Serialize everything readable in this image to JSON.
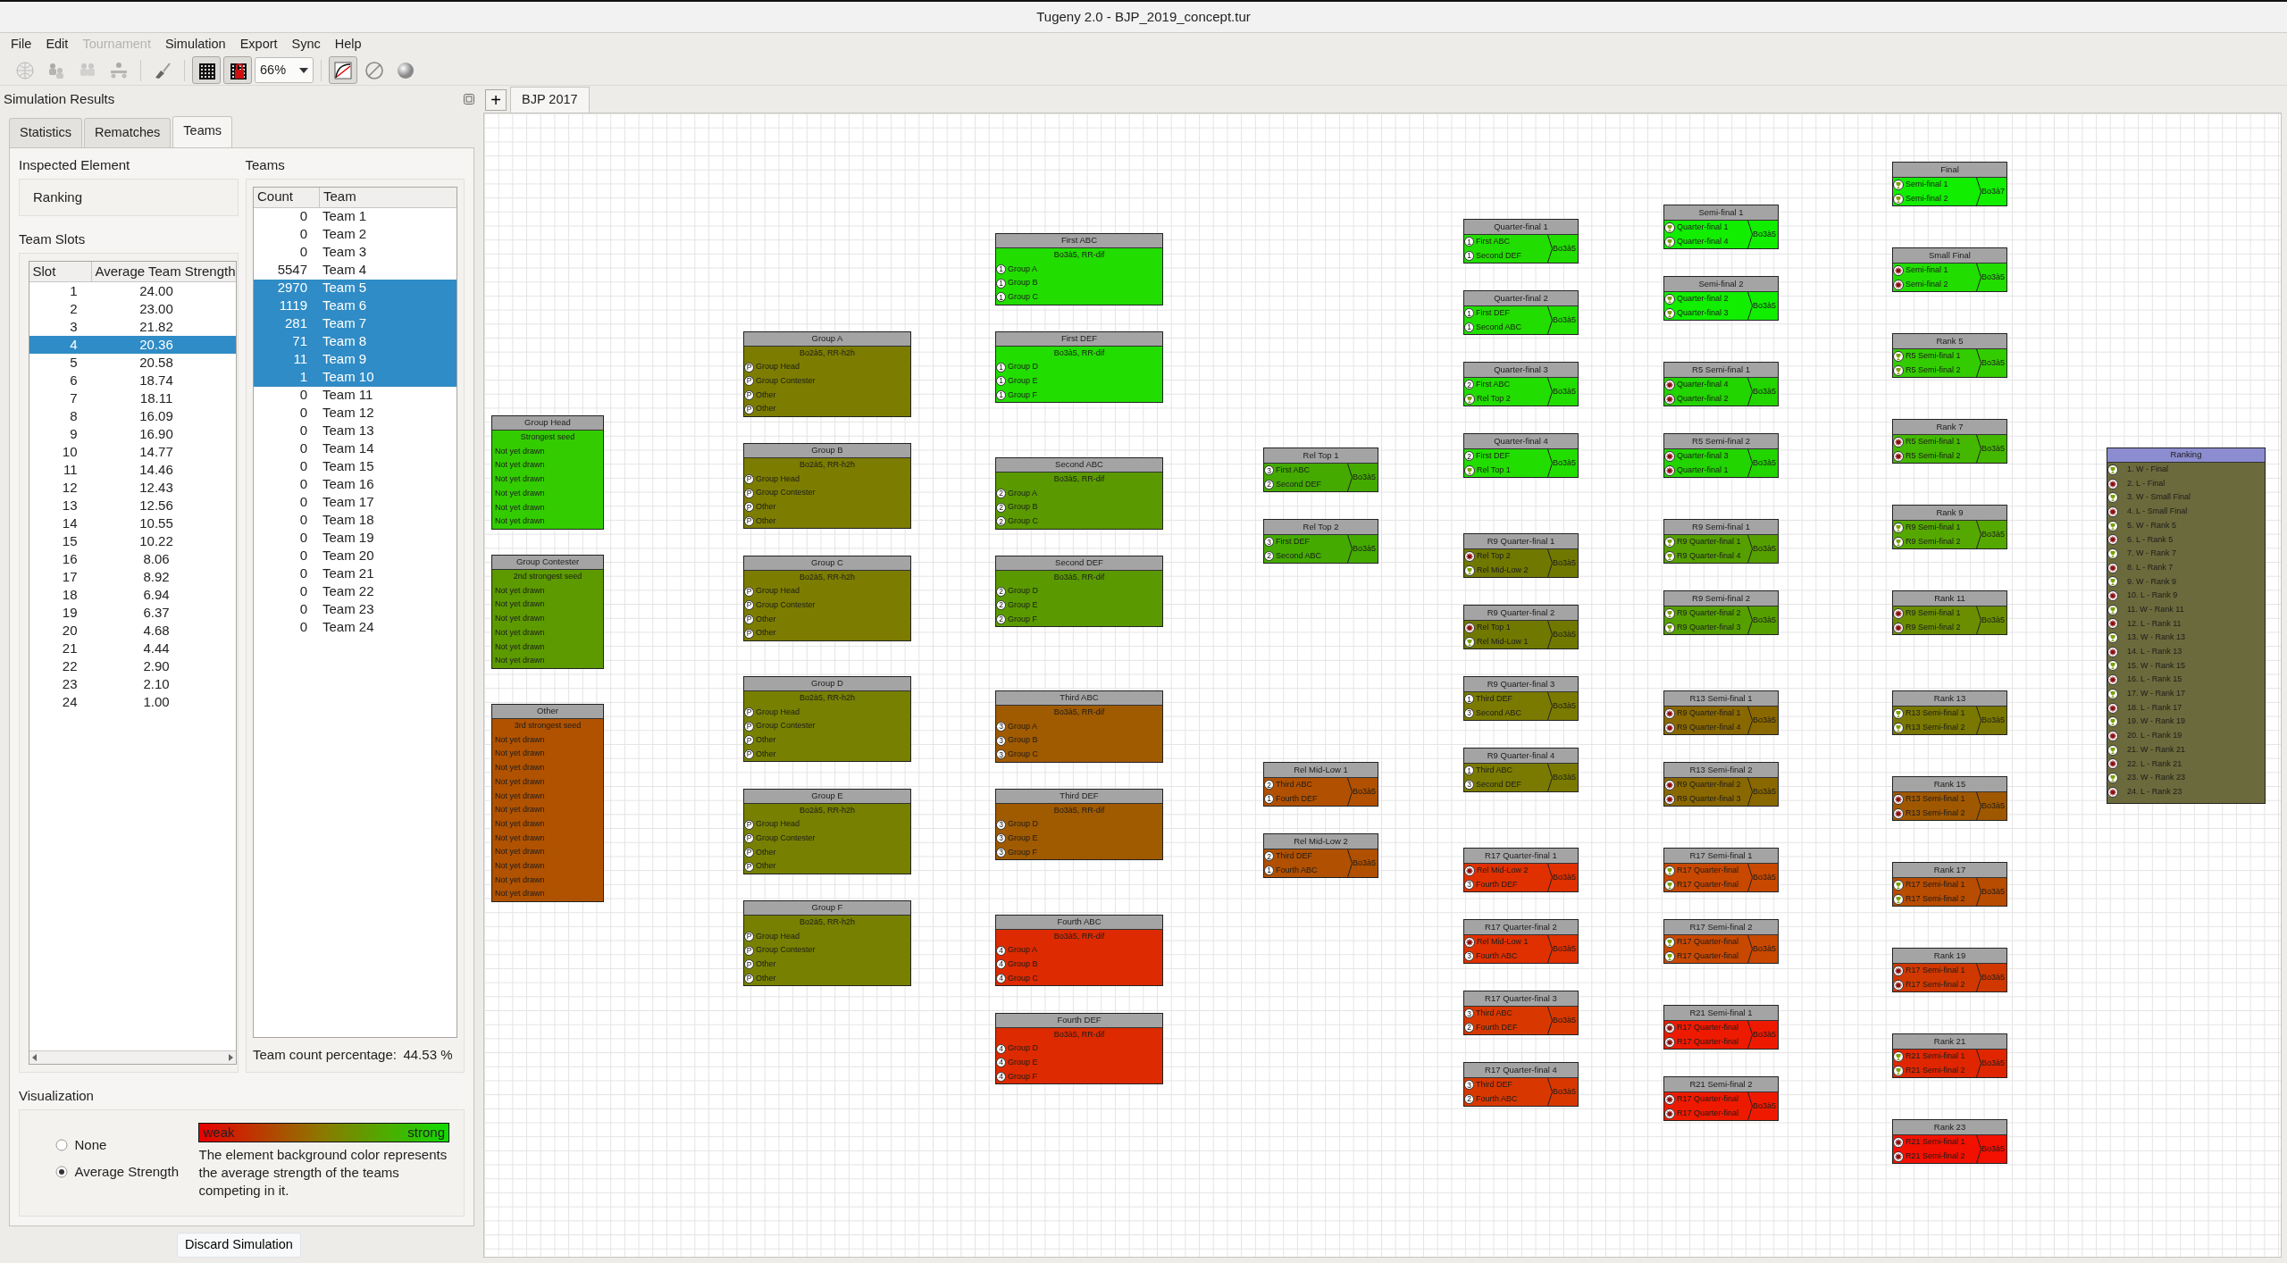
{
  "window": {
    "title": "Tugeny 2.0 - BJP_2019_concept.tur"
  },
  "menu": [
    {
      "label": "File",
      "disabled": false
    },
    {
      "label": "Edit",
      "disabled": false
    },
    {
      "label": "Tournament",
      "disabled": true
    },
    {
      "label": "Simulation",
      "disabled": false
    },
    {
      "label": "Export",
      "disabled": false
    },
    {
      "label": "Sync",
      "disabled": false
    },
    {
      "label": "Help",
      "disabled": false
    }
  ],
  "toolbar": {
    "zoom": "66%",
    "buttons": [
      {
        "kind": "globe",
        "disabled": true,
        "pressed": false
      },
      {
        "kind": "people-add",
        "disabled": true,
        "pressed": false
      },
      {
        "kind": "people-swap",
        "disabled": true,
        "pressed": false
      },
      {
        "kind": "network",
        "disabled": true,
        "pressed": false
      },
      {
        "kind": "brush",
        "disabled": false,
        "pressed": false
      },
      {
        "kind": "grid",
        "disabled": false,
        "pressed": true
      },
      {
        "kind": "grid-lock",
        "disabled": false,
        "pressed": true
      },
      {
        "kind": "zoom"
      },
      {
        "kind": "curve",
        "disabled": false,
        "pressed": true
      },
      {
        "kind": "forbid",
        "disabled": false,
        "pressed": false
      },
      {
        "kind": "sphere",
        "disabled": false,
        "pressed": false
      }
    ]
  },
  "panel": {
    "title": "Simulation Results",
    "tabs": [
      {
        "label": "Statistics",
        "selected": false
      },
      {
        "label": "Rematches",
        "selected": false
      },
      {
        "label": "Teams",
        "selected": true
      }
    ],
    "inspected_element": {
      "label": "Inspected Element",
      "value": "Ranking"
    },
    "team_slots": {
      "label": "Team Slots",
      "columns": [
        "Slot",
        "Average Team Strength"
      ],
      "rows": [
        {
          "slot": "1",
          "strength": "24.00",
          "selected": false
        },
        {
          "slot": "2",
          "strength": "23.00",
          "selected": false
        },
        {
          "slot": "3",
          "strength": "21.82",
          "selected": false
        },
        {
          "slot": "4",
          "strength": "20.36",
          "selected": true
        },
        {
          "slot": "5",
          "strength": "20.58",
          "selected": false
        },
        {
          "slot": "6",
          "strength": "18.74",
          "selected": false
        },
        {
          "slot": "7",
          "strength": "18.11",
          "selected": false
        },
        {
          "slot": "8",
          "strength": "16.09",
          "selected": false
        },
        {
          "slot": "9",
          "strength": "16.90",
          "selected": false
        },
        {
          "slot": "10",
          "strength": "14.77",
          "selected": false
        },
        {
          "slot": "11",
          "strength": "14.46",
          "selected": false
        },
        {
          "slot": "12",
          "strength": "12.43",
          "selected": false
        },
        {
          "slot": "13",
          "strength": "12.56",
          "selected": false
        },
        {
          "slot": "14",
          "strength": "10.55",
          "selected": false
        },
        {
          "slot": "15",
          "strength": "10.22",
          "selected": false
        },
        {
          "slot": "16",
          "strength": "8.06",
          "selected": false
        },
        {
          "slot": "17",
          "strength": "8.92",
          "selected": false
        },
        {
          "slot": "18",
          "strength": "6.94",
          "selected": false
        },
        {
          "slot": "19",
          "strength": "6.37",
          "selected": false
        },
        {
          "slot": "20",
          "strength": "4.68",
          "selected": false
        },
        {
          "slot": "21",
          "strength": "4.44",
          "selected": false
        },
        {
          "slot": "22",
          "strength": "2.90",
          "selected": false
        },
        {
          "slot": "23",
          "strength": "2.10",
          "selected": false
        },
        {
          "slot": "24",
          "strength": "1.00",
          "selected": false
        }
      ]
    },
    "teams": {
      "label": "Teams",
      "columns": [
        "Count",
        "Team"
      ],
      "rows": [
        {
          "count": "0",
          "team": "Team 1",
          "selected": false
        },
        {
          "count": "0",
          "team": "Team 2",
          "selected": false
        },
        {
          "count": "0",
          "team": "Team 3",
          "selected": false
        },
        {
          "count": "5547",
          "team": "Team 4",
          "selected": false
        },
        {
          "count": "2970",
          "team": "Team 5",
          "selected": true
        },
        {
          "count": "1119",
          "team": "Team 6",
          "selected": true
        },
        {
          "count": "281",
          "team": "Team 7",
          "selected": true
        },
        {
          "count": "71",
          "team": "Team 8",
          "selected": true
        },
        {
          "count": "11",
          "team": "Team 9",
          "selected": true
        },
        {
          "count": "1",
          "team": "Team 10",
          "selected": true
        },
        {
          "count": "0",
          "team": "Team 11",
          "selected": false
        },
        {
          "count": "0",
          "team": "Team 12",
          "selected": false
        },
        {
          "count": "0",
          "team": "Team 13",
          "selected": false
        },
        {
          "count": "0",
          "team": "Team 14",
          "selected": false
        },
        {
          "count": "0",
          "team": "Team 15",
          "selected": false
        },
        {
          "count": "0",
          "team": "Team 16",
          "selected": false
        },
        {
          "count": "0",
          "team": "Team 17",
          "selected": false
        },
        {
          "count": "0",
          "team": "Team 18",
          "selected": false
        },
        {
          "count": "0",
          "team": "Team 19",
          "selected": false
        },
        {
          "count": "0",
          "team": "Team 20",
          "selected": false
        },
        {
          "count": "0",
          "team": "Team 21",
          "selected": false
        },
        {
          "count": "0",
          "team": "Team 22",
          "selected": false
        },
        {
          "count": "0",
          "team": "Team 23",
          "selected": false
        },
        {
          "count": "0",
          "team": "Team 24",
          "selected": false
        }
      ],
      "percentage_label": "Team count percentage:",
      "percentage": "44.53 %"
    },
    "visualization": {
      "label": "Visualization",
      "options": [
        {
          "label": "None",
          "selected": false
        },
        {
          "label": "Average Strength",
          "selected": true
        }
      ],
      "legend": {
        "low": "weak",
        "high": "strong"
      },
      "description": "The element background color represents the average strength of the teams competing in it."
    },
    "discard_button": "Discard Simulation"
  },
  "document": {
    "new_tab_button": "+",
    "tabs": [
      {
        "label": "BJP 2017",
        "selected": true
      }
    ],
    "nodes": [
      {
        "kind": "seed",
        "title": "Group Head",
        "subtitle": "Strongest seed",
        "color": "#33cc00",
        "selected": false,
        "inputs": [
          {
            "label": "Not yet drawn"
          },
          {
            "label": "Not yet drawn"
          },
          {
            "label": "Not yet drawn"
          },
          {
            "label": "Not yet drawn"
          },
          {
            "label": "Not yet drawn"
          },
          {
            "label": "Not yet drawn"
          }
        ]
      },
      {
        "kind": "seed",
        "title": "Group Contester",
        "subtitle": "2nd strongest seed",
        "color": "#5c9a00",
        "selected": false,
        "inputs": [
          {
            "label": "Not yet drawn"
          },
          {
            "label": "Not yet drawn"
          },
          {
            "label": "Not yet drawn"
          },
          {
            "label": "Not yet drawn"
          },
          {
            "label": "Not yet drawn"
          },
          {
            "label": "Not yet drawn"
          }
        ]
      },
      {
        "kind": "seed",
        "title": "Other",
        "subtitle": "3rd strongest seed",
        "color": "#b05200",
        "selected": false,
        "inputs": [
          {
            "label": "Not yet drawn"
          },
          {
            "label": "Not yet drawn"
          },
          {
            "label": "Not yet drawn"
          },
          {
            "label": "Not yet drawn"
          },
          {
            "label": "Not yet drawn"
          },
          {
            "label": "Not yet drawn"
          },
          {
            "label": "Not yet drawn"
          },
          {
            "label": "Not yet drawn"
          },
          {
            "label": "Not yet drawn"
          },
          {
            "label": "Not yet drawn"
          },
          {
            "label": "Not yet drawn"
          },
          {
            "label": "Not yet drawn"
          }
        ]
      },
      {
        "kind": "group",
        "title": "Group A",
        "subtitle": "Bo2à5, RR-h2h",
        "color": "#7c7c00",
        "selected": false,
        "inputs": [
          {
            "port": "P",
            "label": "Group Head"
          },
          {
            "port": "P",
            "label": "Group Contester"
          },
          {
            "port": "P",
            "label": "Other"
          },
          {
            "port": "P",
            "label": "Other"
          }
        ]
      },
      {
        "kind": "group",
        "title": "Group B",
        "subtitle": "Bo2à5, RR-h2h",
        "color": "#7c7c00",
        "selected": false,
        "inputs": [
          {
            "port": "P",
            "label": "Group Head"
          },
          {
            "port": "P",
            "label": "Group Contester"
          },
          {
            "port": "P",
            "label": "Other"
          },
          {
            "port": "P",
            "label": "Other"
          }
        ]
      },
      {
        "kind": "group",
        "title": "Group C",
        "subtitle": "Bo2à5, RR-h2h",
        "color": "#7c7c00",
        "selected": false,
        "inputs": [
          {
            "port": "P",
            "label": "Group Head"
          },
          {
            "port": "P",
            "label": "Group Contester"
          },
          {
            "port": "P",
            "label": "Other"
          },
          {
            "port": "P",
            "label": "Other"
          }
        ]
      },
      {
        "kind": "group",
        "title": "Group D",
        "subtitle": "Bo2à5, RR-h2h",
        "color": "#778000",
        "selected": false,
        "inputs": [
          {
            "port": "P",
            "label": "Group Head"
          },
          {
            "port": "P",
            "label": "Group Contester"
          },
          {
            "port": "P",
            "label": "Other"
          },
          {
            "port": "P",
            "label": "Other"
          }
        ]
      },
      {
        "kind": "group",
        "title": "Group E",
        "subtitle": "Bo2à5, RR-h2h",
        "color": "#778000",
        "selected": false,
        "inputs": [
          {
            "port": "P",
            "label": "Group Head"
          },
          {
            "port": "P",
            "label": "Group Contester"
          },
          {
            "port": "P",
            "label": "Other"
          },
          {
            "port": "P",
            "label": "Other"
          }
        ]
      },
      {
        "kind": "group",
        "title": "Group F",
        "subtitle": "Bo2à5, RR-h2h",
        "color": "#778000",
        "selected": false,
        "inputs": [
          {
            "port": "P",
            "label": "Group Head"
          },
          {
            "port": "P",
            "label": "Group Contester"
          },
          {
            "port": "P",
            "label": "Other"
          },
          {
            "port": "P",
            "label": "Other"
          }
        ]
      },
      {
        "kind": "group",
        "title": "First ABC",
        "subtitle": "Bo3à5, RR-dif",
        "color": "#22dd00",
        "selected": false,
        "inputs": [
          {
            "port": "1",
            "label": "Group A"
          },
          {
            "port": "1",
            "label": "Group B"
          },
          {
            "port": "1",
            "label": "Group C"
          }
        ]
      },
      {
        "kind": "group",
        "title": "First DEF",
        "subtitle": "Bo3à5, RR-dif",
        "color": "#22dd00",
        "selected": false,
        "inputs": [
          {
            "port": "1",
            "label": "Group D"
          },
          {
            "port": "1",
            "label": "Group E"
          },
          {
            "port": "1",
            "label": "Group F"
          }
        ]
      },
      {
        "kind": "group",
        "title": "Second ABC",
        "subtitle": "Bo3à5, RR-dif",
        "color": "#5a9a00",
        "selected": false,
        "inputs": [
          {
            "port": "2",
            "label": "Group A"
          },
          {
            "port": "2",
            "label": "Group B"
          },
          {
            "port": "2",
            "label": "Group C"
          }
        ]
      },
      {
        "kind": "group",
        "title": "Second DEF",
        "subtitle": "Bo3à5, RR-dif",
        "color": "#5a9a00",
        "selected": false,
        "inputs": [
          {
            "port": "2",
            "label": "Group D"
          },
          {
            "port": "2",
            "label": "Group E"
          },
          {
            "port": "2",
            "label": "Group F"
          }
        ]
      },
      {
        "kind": "group",
        "title": "Third ABC",
        "subtitle": "Bo3à5, RR-dif",
        "color": "#a05a00",
        "selected": false,
        "inputs": [
          {
            "port": "3",
            "label": "Group A"
          },
          {
            "port": "3",
            "label": "Group B"
          },
          {
            "port": "3",
            "label": "Group C"
          }
        ]
      },
      {
        "kind": "group",
        "title": "Third DEF",
        "subtitle": "Bo3à5, RR-dif",
        "color": "#a05a00",
        "selected": false,
        "inputs": [
          {
            "port": "3",
            "label": "Group D"
          },
          {
            "port": "3",
            "label": "Group E"
          },
          {
            "port": "3",
            "label": "Group F"
          }
        ]
      },
      {
        "kind": "group",
        "title": "Fourth ABC",
        "subtitle": "Bo3à5, RR-dif",
        "color": "#dd2a00",
        "selected": false,
        "inputs": [
          {
            "port": "4",
            "label": "Group A"
          },
          {
            "port": "4",
            "label": "Group B"
          },
          {
            "port": "4",
            "label": "Group C"
          }
        ]
      },
      {
        "kind": "group",
        "title": "Fourth DEF",
        "subtitle": "Bo3à5, RR-dif",
        "color": "#dd2a00",
        "selected": false,
        "inputs": [
          {
            "port": "4",
            "label": "Group D"
          },
          {
            "port": "4",
            "label": "Group E"
          },
          {
            "port": "4",
            "label": "Group F"
          }
        ]
      },
      {
        "kind": "match",
        "title": "Rel Top 1",
        "format": "Bo3à5",
        "color": "#44aa00",
        "selected": false,
        "inputs": [
          {
            "port": "3",
            "label": "First ABC"
          },
          {
            "port": "2",
            "label": "Second DEF"
          }
        ]
      },
      {
        "kind": "match",
        "title": "Rel Top 2",
        "format": "Bo3à5",
        "color": "#44aa00",
        "selected": false,
        "inputs": [
          {
            "port": "3",
            "label": "First DEF"
          },
          {
            "port": "2",
            "label": "Second ABC"
          }
        ]
      },
      {
        "kind": "match",
        "title": "Rel Mid-Low 1",
        "format": "Bo3à5",
        "color": "#b05000",
        "selected": false,
        "inputs": [
          {
            "port": "2",
            "label": "Third ABC"
          },
          {
            "port": "1",
            "label": "Fourth DEF"
          }
        ]
      },
      {
        "kind": "match",
        "title": "Rel Mid-Low 2",
        "format": "Bo3à5",
        "color": "#b05000",
        "selected": false,
        "inputs": [
          {
            "port": "2",
            "label": "Third DEF"
          },
          {
            "port": "1",
            "label": "Fourth ABC"
          }
        ]
      },
      {
        "kind": "match",
        "title": "Quarter-final 1",
        "format": "Bo3à5",
        "color": "#22dd00",
        "selected": false,
        "inputs": [
          {
            "port": "1",
            "label": "First ABC"
          },
          {
            "port": "1",
            "label": "Second DEF"
          }
        ]
      },
      {
        "kind": "match",
        "title": "Quarter-final 2",
        "format": "Bo3à5",
        "color": "#22dd00",
        "selected": false,
        "inputs": [
          {
            "port": "1",
            "label": "First DEF"
          },
          {
            "port": "1",
            "label": "Second ABC"
          }
        ]
      },
      {
        "kind": "match",
        "title": "Quarter-final 3",
        "format": "Bo3à5",
        "color": "#22dd00",
        "selected": false,
        "inputs": [
          {
            "port": "2",
            "label": "First ABC"
          },
          {
            "kind": "winner",
            "label": "Rel Top 2"
          }
        ]
      },
      {
        "kind": "match",
        "title": "Quarter-final 4",
        "format": "Bo3à5",
        "color": "#22dd00",
        "selected": false,
        "inputs": [
          {
            "port": "2",
            "label": "First DEF"
          },
          {
            "kind": "winner",
            "label": "Rel Top 1"
          }
        ]
      },
      {
        "kind": "match",
        "title": "R9 Quarter-final 1",
        "format": "Bo3à5",
        "color": "#707800",
        "selected": false,
        "inputs": [
          {
            "kind": "loser",
            "label": "Rel Top 2"
          },
          {
            "kind": "winner",
            "label": "Rel Mid-Low 2"
          }
        ]
      },
      {
        "kind": "match",
        "title": "R9 Quarter-final 2",
        "format": "Bo3à5",
        "color": "#707800",
        "selected": false,
        "inputs": [
          {
            "kind": "loser",
            "label": "Rel Top 1"
          },
          {
            "kind": "winner",
            "label": "Rel Mid-Low 1"
          }
        ]
      },
      {
        "kind": "match",
        "title": "R9 Quarter-final 3",
        "format": "Bo3à5",
        "color": "#7a7a00",
        "selected": false,
        "inputs": [
          {
            "port": "1",
            "label": "Third DEF"
          },
          {
            "port": "3",
            "label": "Second ABC"
          }
        ]
      },
      {
        "kind": "match",
        "title": "R9 Quarter-final 4",
        "format": "Bo3à5",
        "color": "#7a7a00",
        "selected": false,
        "inputs": [
          {
            "port": "1",
            "label": "Third ABC"
          },
          {
            "port": "3",
            "label": "Second DEF"
          }
        ]
      },
      {
        "kind": "match",
        "title": "R17 Quarter-final 1",
        "format": "Bo3à5",
        "color": "#e03000",
        "selected": false,
        "inputs": [
          {
            "kind": "loser",
            "label": "Rel Mid-Low 2"
          },
          {
            "port": "3",
            "label": "Fourth DEF"
          }
        ]
      },
      {
        "kind": "match",
        "title": "R17 Quarter-final 2",
        "format": "Bo3à5",
        "color": "#e03000",
        "selected": false,
        "inputs": [
          {
            "kind": "loser",
            "label": "Rel Mid-Low 1"
          },
          {
            "port": "3",
            "label": "Fourth ABC"
          }
        ]
      },
      {
        "kind": "match",
        "title": "R17 Quarter-final 3",
        "format": "Bo3à5",
        "color": "#d83800",
        "selected": false,
        "inputs": [
          {
            "port": "3",
            "label": "Third ABC"
          },
          {
            "port": "2",
            "label": "Fourth DEF"
          }
        ]
      },
      {
        "kind": "match",
        "title": "R17 Quarter-final 4",
        "format": "Bo3à5",
        "color": "#d83800",
        "selected": false,
        "inputs": [
          {
            "port": "3",
            "label": "Third DEF"
          },
          {
            "port": "2",
            "label": "Fourth ABC"
          }
        ]
      },
      {
        "kind": "match",
        "title": "Semi-final 1",
        "format": "Bo3à5",
        "color": "#11ee00",
        "selected": false,
        "inputs": [
          {
            "kind": "winner",
            "label": "Quarter-final 1"
          },
          {
            "kind": "winner",
            "label": "Quarter-final 4"
          }
        ]
      },
      {
        "kind": "match",
        "title": "Semi-final 2",
        "format": "Bo3à5",
        "color": "#11ee00",
        "selected": false,
        "inputs": [
          {
            "kind": "winner",
            "label": "Quarter-final 2"
          },
          {
            "kind": "winner",
            "label": "Quarter-final 3"
          }
        ]
      },
      {
        "kind": "match",
        "title": "R5 Semi-final 1",
        "format": "Bo3à5",
        "color": "#22d400",
        "selected": false,
        "inputs": [
          {
            "kind": "loser",
            "label": "Quarter-final 4"
          },
          {
            "kind": "loser",
            "label": "Quarter-final 2"
          }
        ]
      },
      {
        "kind": "match",
        "title": "R5 Semi-final 2",
        "format": "Bo3à5",
        "color": "#22d400",
        "selected": false,
        "inputs": [
          {
            "kind": "loser",
            "label": "Quarter-final 3"
          },
          {
            "kind": "loser",
            "label": "Quarter-final 1"
          }
        ]
      },
      {
        "kind": "match",
        "title": "R9 Semi-final 1",
        "format": "Bo3à5",
        "color": "#55a000",
        "selected": false,
        "inputs": [
          {
            "kind": "winner",
            "label": "R9 Quarter-final 1"
          },
          {
            "kind": "winner",
            "label": "R9 Quarter-final 4"
          }
        ]
      },
      {
        "kind": "match",
        "title": "R9 Semi-final 2",
        "format": "Bo3à5",
        "color": "#55a000",
        "selected": false,
        "inputs": [
          {
            "kind": "winner",
            "label": "R9 Quarter-final 2"
          },
          {
            "kind": "winner",
            "label": "R9 Quarter-final 3"
          }
        ]
      },
      {
        "kind": "match",
        "title": "R13 Semi-final 1",
        "format": "Bo3à5",
        "color": "#8a6800",
        "selected": false,
        "inputs": [
          {
            "kind": "loser",
            "label": "R9 Quarter-final 1"
          },
          {
            "kind": "loser",
            "label": "R9 Quarter-final 4"
          }
        ]
      },
      {
        "kind": "match",
        "title": "R13 Semi-final 2",
        "format": "Bo3à5",
        "color": "#8a6800",
        "selected": false,
        "inputs": [
          {
            "kind": "loser",
            "label": "R9 Quarter-final 2"
          },
          {
            "kind": "loser",
            "label": "R9 Quarter-final 3"
          }
        ]
      },
      {
        "kind": "match",
        "title": "R17 Semi-final 1",
        "format": "Bo3à5",
        "color": "#c84800",
        "selected": false,
        "inputs": [
          {
            "kind": "winner",
            "label": "R17 Quarter-final"
          },
          {
            "kind": "winner",
            "label": "R17 Quarter-final"
          }
        ]
      },
      {
        "kind": "match",
        "title": "R17 Semi-final 2",
        "format": "Bo3à5",
        "color": "#c84800",
        "selected": false,
        "inputs": [
          {
            "kind": "winner",
            "label": "R17 Quarter-final"
          },
          {
            "kind": "winner",
            "label": "R17 Quarter-final"
          }
        ]
      },
      {
        "kind": "match",
        "title": "R21 Semi-final 1",
        "format": "Bo3à5",
        "color": "#ee1a00",
        "selected": false,
        "inputs": [
          {
            "kind": "loser",
            "label": "R17 Quarter-final"
          },
          {
            "kind": "loser",
            "label": "R17 Quarter-final"
          }
        ]
      },
      {
        "kind": "match",
        "title": "R21 Semi-final 2",
        "format": "Bo3à5",
        "color": "#ee1a00",
        "selected": false,
        "inputs": [
          {
            "kind": "loser",
            "label": "R17 Quarter-final"
          },
          {
            "kind": "loser",
            "label": "R17 Quarter-final"
          }
        ]
      },
      {
        "kind": "match",
        "title": "Final",
        "format": "Bo3à7",
        "color": "#11ee00",
        "selected": false,
        "inputs": [
          {
            "kind": "winner",
            "label": "Semi-final 1"
          },
          {
            "kind": "winner",
            "label": "Semi-final 2"
          }
        ]
      },
      {
        "kind": "match",
        "title": "Small Final",
        "format": "Bo3à5",
        "color": "#22dd00",
        "selected": false,
        "inputs": [
          {
            "kind": "loser",
            "label": "Semi-final 1"
          },
          {
            "kind": "loser",
            "label": "Semi-final 2"
          }
        ]
      },
      {
        "kind": "match",
        "title": "Rank 5",
        "format": "Bo3à5",
        "color": "#33cc00",
        "selected": false,
        "inputs": [
          {
            "kind": "winner",
            "label": "R5 Semi-final 1"
          },
          {
            "kind": "winner",
            "label": "R5 Semi-final 2"
          }
        ]
      },
      {
        "kind": "match",
        "title": "Rank 7",
        "format": "Bo3à5",
        "color": "#44b800",
        "selected": false,
        "inputs": [
          {
            "kind": "loser",
            "label": "R5 Semi-final 1"
          },
          {
            "kind": "loser",
            "label": "R5 Semi-final 2"
          }
        ]
      },
      {
        "kind": "match",
        "title": "Rank 9",
        "format": "Bo3à5",
        "color": "#55a800",
        "selected": false,
        "inputs": [
          {
            "kind": "winner",
            "label": "R9 Semi-final 1"
          },
          {
            "kind": "winner",
            "label": "R9 Semi-final 2"
          }
        ]
      },
      {
        "kind": "match",
        "title": "Rank 11",
        "format": "Bo3à5",
        "color": "#6a8e00",
        "selected": false,
        "inputs": [
          {
            "kind": "loser",
            "label": "R9 Semi-final 1"
          },
          {
            "kind": "loser",
            "label": "R9 Semi-final 2"
          }
        ]
      },
      {
        "kind": "match",
        "title": "Rank 13",
        "format": "Bo3à5",
        "color": "#7a7800",
        "selected": false,
        "inputs": [
          {
            "kind": "winner",
            "label": "R13 Semi-final 1"
          },
          {
            "kind": "winner",
            "label": "R13 Semi-final 2"
          }
        ]
      },
      {
        "kind": "match",
        "title": "Rank 15",
        "format": "Bo3à5",
        "color": "#a05800",
        "selected": false,
        "inputs": [
          {
            "kind": "loser",
            "label": "R13 Semi-final 1"
          },
          {
            "kind": "loser",
            "label": "R13 Semi-final 2"
          }
        ]
      },
      {
        "kind": "match",
        "title": "Rank 17",
        "format": "Bo3à5",
        "color": "#b84c00",
        "selected": false,
        "inputs": [
          {
            "kind": "winner",
            "label": "R17 Semi-final 1"
          },
          {
            "kind": "winner",
            "label": "R17 Semi-final 2"
          }
        ]
      },
      {
        "kind": "match",
        "title": "Rank 19",
        "format": "Bo3à5",
        "color": "#d03800",
        "selected": false,
        "inputs": [
          {
            "kind": "loser",
            "label": "R17 Semi-final 1"
          },
          {
            "kind": "loser",
            "label": "R17 Semi-final 2"
          }
        ]
      },
      {
        "kind": "match",
        "title": "Rank 21",
        "format": "Bo3à5",
        "color": "#e02600",
        "selected": false,
        "inputs": [
          {
            "kind": "winner",
            "label": "R21 Semi-final 1"
          },
          {
            "kind": "winner",
            "label": "R21 Semi-final 2"
          }
        ]
      },
      {
        "kind": "match",
        "title": "Rank 23",
        "format": "Bo3à5",
        "color": "#f21000",
        "selected": false,
        "inputs": [
          {
            "kind": "loser",
            "label": "R21 Semi-final 1"
          },
          {
            "kind": "loser",
            "label": "R21 Semi-final 2"
          }
        ]
      },
      {
        "kind": "ranking",
        "title": "Ranking",
        "color": "#6b6a3c",
        "selected": true,
        "inputs": [
          {
            "kind": "winner",
            "label": "1. W - Final"
          },
          {
            "kind": "loser",
            "label": "2. L - Final"
          },
          {
            "kind": "winner",
            "label": "3. W - Small Final"
          },
          {
            "kind": "loser",
            "label": "4. L - Small Final"
          },
          {
            "kind": "winner",
            "label": "5. W - Rank 5"
          },
          {
            "kind": "loser",
            "label": "6. L - Rank 5"
          },
          {
            "kind": "winner",
            "label": "7. W - Rank 7"
          },
          {
            "kind": "loser",
            "label": "8. L - Rank 7"
          },
          {
            "kind": "winner",
            "label": "9. W - Rank 9"
          },
          {
            "kind": "loser",
            "label": "10. L - Rank 9"
          },
          {
            "kind": "winner",
            "label": "11. W - Rank 11"
          },
          {
            "kind": "loser",
            "label": "12. L - Rank 11"
          },
          {
            "kind": "winner",
            "label": "13. W - Rank 13"
          },
          {
            "kind": "loser",
            "label": "14. L - Rank 13"
          },
          {
            "kind": "winner",
            "label": "15. W - Rank 15"
          },
          {
            "kind": "loser",
            "label": "16. L - Rank 15"
          },
          {
            "kind": "winner",
            "label": "17. W - Rank 17"
          },
          {
            "kind": "loser",
            "label": "18. L - Rank 17"
          },
          {
            "kind": "winner",
            "label": "19. W - Rank 19"
          },
          {
            "kind": "loser",
            "label": "20. L - Rank 19"
          },
          {
            "kind": "winner",
            "label": "21. W - Rank 21"
          },
          {
            "kind": "loser",
            "label": "22. L - Rank 21"
          },
          {
            "kind": "winner",
            "label": "23. W - Rank 23"
          },
          {
            "kind": "loser",
            "label": "24. L - Rank 23"
          }
        ]
      }
    ]
  }
}
